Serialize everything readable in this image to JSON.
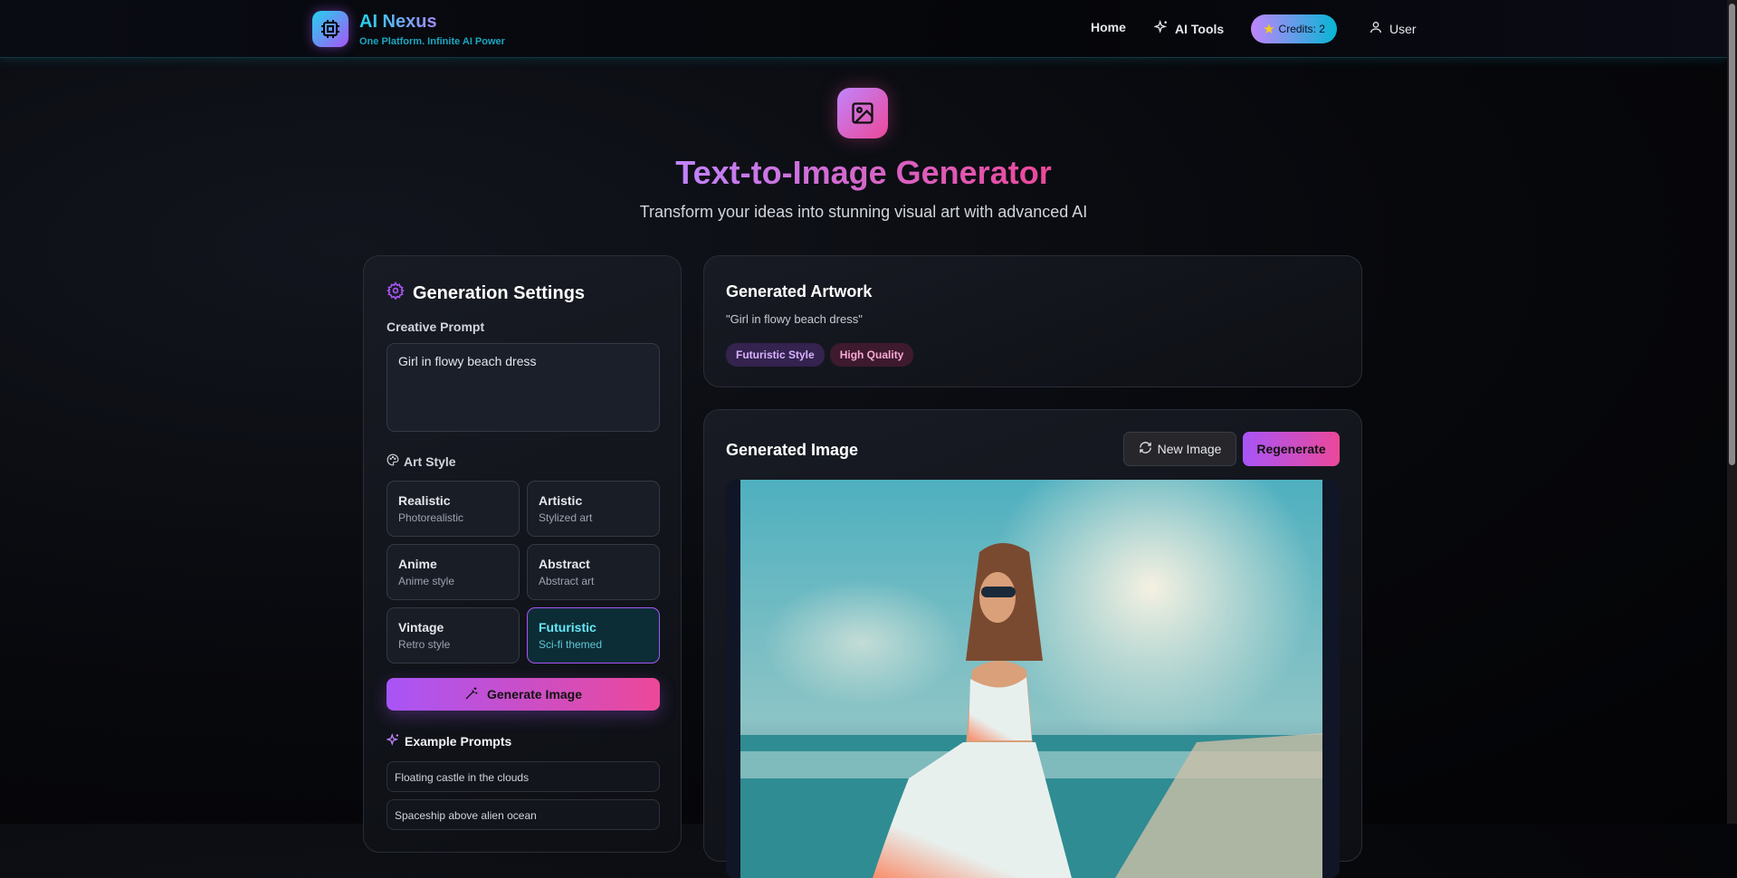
{
  "header": {
    "brand": "AI Nexus",
    "tagline": "One Platform. Infinite AI Power",
    "nav": {
      "home": "Home",
      "ai_tools": "AI Tools",
      "credits": "Credits: 2",
      "user": "User"
    }
  },
  "hero": {
    "title": "Text-to-Image Generator",
    "subtitle": "Transform your ideas into stunning visual art with advanced AI"
  },
  "settings": {
    "title": "Generation Settings",
    "prompt_label": "Creative Prompt",
    "prompt_value": "Girl in flowy beach dress",
    "art_style_label": "Art Style",
    "styles": [
      {
        "name": "Realistic",
        "desc": "Photorealistic"
      },
      {
        "name": "Artistic",
        "desc": "Stylized art"
      },
      {
        "name": "Anime",
        "desc": "Anime style"
      },
      {
        "name": "Abstract",
        "desc": "Abstract art"
      },
      {
        "name": "Vintage",
        "desc": "Retro style"
      },
      {
        "name": "Futuristic",
        "desc": "Sci-fi themed",
        "selected": true
      }
    ],
    "generate_label": "Generate Image",
    "examples_label": "Example Prompts",
    "examples": [
      "Floating castle in the clouds",
      "Spaceship above alien ocean"
    ]
  },
  "artwork": {
    "title": "Generated Artwork",
    "prompt_quote": "\"Girl in flowy beach dress\"",
    "badges": [
      "Futuristic Style",
      "High Quality"
    ]
  },
  "image": {
    "title": "Generated Image",
    "new_label": "New Image",
    "regen_label": "Regenerate"
  },
  "colors": {
    "accent_purple": "#a855f7",
    "accent_pink": "#ec4899",
    "accent_cyan": "#22d3ee"
  }
}
